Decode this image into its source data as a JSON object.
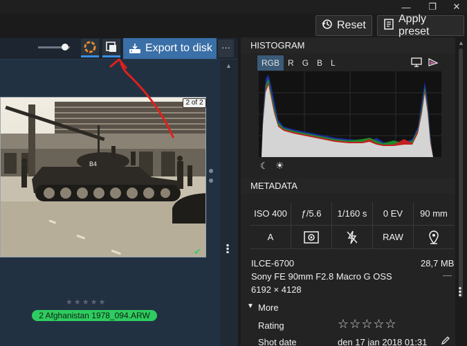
{
  "toolbar": {
    "reset_label": "Reset",
    "apply_preset_label": "Apply preset",
    "export_label": "Export to disk",
    "more_label": "···"
  },
  "viewer": {
    "counter": "2 of 2",
    "filename": "2 Afghanistan 1978_094.ARW",
    "rating_stars": "★★★★★"
  },
  "histogram": {
    "title": "HISTOGRAM",
    "tabs": [
      "RGB",
      "R",
      "G",
      "B",
      "L"
    ],
    "active_tab": "RGB"
  },
  "metadata": {
    "title": "METADATA",
    "exif_row": [
      "ISO 400",
      "ƒ/5.6",
      "1/160 s",
      "0 EV",
      "90 mm"
    ],
    "mode": "A",
    "format": "RAW",
    "camera": "ILCE-6700",
    "size": "28,7 MB",
    "lens": "Sony FE 90mm F2.8 Macro G OSS",
    "lens_extra": "—",
    "dimensions": "6192 × 4128",
    "more_label": "More",
    "rating_label": "Rating",
    "rating_value": "☆☆☆☆☆",
    "shot_date_label": "Shot date",
    "shot_date_value": "den 17 jan 2018 01:31"
  },
  "colors": {
    "accent": "#3a6fa8",
    "filename_badge": "#2ecc60",
    "annotation": "#e0201c"
  }
}
